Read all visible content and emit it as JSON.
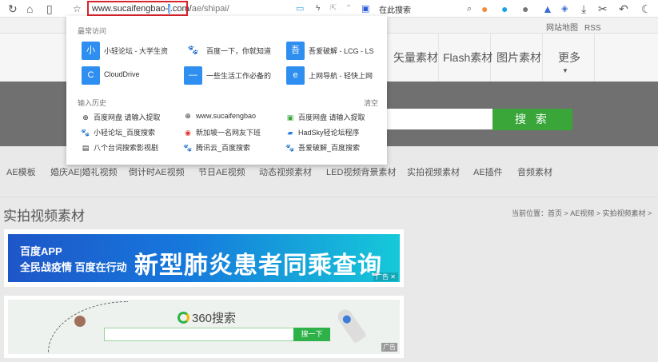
{
  "browser": {
    "url_highlight": "sucaifengbao-",
    "url_prefix": "www.",
    "url_cursor_char": "j",
    "url_mid": ".com/",
    "url_rest": "ae/shipai/",
    "search_placeholder": "在此搜索"
  },
  "topbar": {
    "links": [
      "网站地图",
      "RSS"
    ]
  },
  "header": {
    "nav": [
      "矢量素材",
      "Flash素材",
      "图片素材",
      "更多"
    ]
  },
  "search": {
    "button": "搜 索"
  },
  "categories": [
    "AE模板",
    "婚庆AE|婚礼视频",
    "倒计时AE视频",
    "节日AE视频",
    "动态视频素材",
    "LED视频背景素材",
    "实拍视频素材",
    "AE插件",
    "音频素材"
  ],
  "page": {
    "title": "实拍视频素材",
    "breadcrumb": "当前位置：首页 > AE视频 > 实拍视频素材 >"
  },
  "ad1": {
    "logo": "百度APP",
    "sub": "全民战疫情 百度在行动",
    "headline": "新型肺炎患者同乘查询",
    "tag": "广告 ✕"
  },
  "ad2": {
    "logo": "360搜索",
    "button": "搜一下",
    "tag": "广告"
  },
  "dropdown": {
    "frequent_title": "最常访问",
    "frequent": [
      {
        "icon": "小",
        "label": "小轻论坛 - 大学生资"
      },
      {
        "icon": "🐾",
        "label": "百度一下，你就知道"
      },
      {
        "icon": "吾",
        "label": "吾爱破解 - LCG - LS"
      },
      {
        "icon": "C",
        "label": "CloudDrive"
      },
      {
        "icon": "—",
        "label": "一些生活工作必备的"
      },
      {
        "icon": "e",
        "label": "上网导航 - 轻快上网"
      }
    ],
    "history_title": "输入历史",
    "clear": "清空",
    "history": [
      {
        "icon": "⊕",
        "label": "百度网盘 请输入提取"
      },
      {
        "icon": "⊕",
        "label": "www.sucaifengbao"
      },
      {
        "icon": "▣",
        "label": "百度网盘 请输入提取"
      },
      {
        "icon": "🐾",
        "label": "小轻论坛_百度搜索"
      },
      {
        "icon": "◉",
        "label": "新加坡一名网友下班"
      },
      {
        "icon": "▰",
        "label": "HadSky轻论坛程序"
      },
      {
        "icon": "▤",
        "label": "八个台词搜索影视剧"
      },
      {
        "icon": "🐾",
        "label": "腾讯云_百度搜索"
      },
      {
        "icon": "🐾",
        "label": "吾爱破解_百度搜索"
      }
    ]
  }
}
